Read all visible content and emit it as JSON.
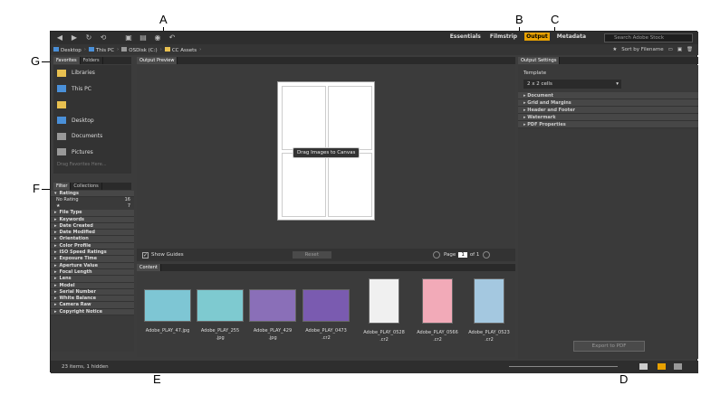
{
  "callouts": {
    "a": "A",
    "b": "B",
    "c": "C",
    "d": "D",
    "e": "E",
    "f": "F",
    "g": "G"
  },
  "toolbar": {
    "workspaces": [
      "Essentials",
      "Filmstrip",
      "Output",
      "Metadata"
    ],
    "active_workspace": "Output",
    "search_placeholder": "Search Adobe Stock"
  },
  "path": {
    "crumbs": [
      "Desktop",
      "This PC",
      "OSDisk (C:)",
      "CC Assets"
    ]
  },
  "pathbar_right": {
    "sort": "Sort by Filename"
  },
  "favorites": {
    "tabs": [
      "Favorites",
      "Folders"
    ],
    "items": [
      "Libraries",
      "This PC",
      " ",
      "Desktop",
      "Documents",
      "Pictures"
    ],
    "hint": "Drag Favorites Here..."
  },
  "filter": {
    "tabs": [
      "Filter",
      "Collections"
    ],
    "sections": [
      "Ratings",
      "File Type",
      "Keywords",
      "Date Created",
      "Date Modified",
      "Orientation",
      "Color Profile",
      "ISO Speed Ratings",
      "Exposure Time",
      "Aperture Value",
      "Focal Length",
      "Lens",
      "Model",
      "Serial Number",
      "White Balance",
      "Camera Raw",
      "Copyright Notice"
    ],
    "ratings": [
      {
        "label": "No Rating",
        "count": "16"
      },
      {
        "label": "★",
        "count": "7"
      }
    ]
  },
  "preview": {
    "tab": "Output Preview",
    "drag_tip": "Drag Images to Canvas",
    "show_guides": "Show Guides",
    "reset": "Reset",
    "page_label": "Page",
    "page_value": "1",
    "page_of": "of 1"
  },
  "content": {
    "tab": "Content",
    "thumbs": [
      "Adobe_PLAY_47.jpg",
      "Adobe_PLAY_255\n.jpg",
      "Adobe_PLAY_429\n.jpg",
      "Adobe_PLAY_0473\n.cr2",
      "Adobe_PLAY_0528\n.cr2",
      "Adobe_PLAY_0566\n.cr2",
      "Adobe_PLAY_0523\n.cr2"
    ],
    "thumb_colors": [
      "#7ec6d4",
      "#7ecad0",
      "#8a6fb8",
      "#7a5bb0",
      "#f0f0f0",
      "#f2aab8",
      "#a4c8e0"
    ]
  },
  "output_settings": {
    "tab": "Output Settings",
    "template_label": "Template",
    "template_value": "2 x 2 cells",
    "sections": [
      "Document",
      "Grid and Margins",
      "Header and Footer",
      "Watermark",
      "PDF Properties"
    ],
    "export": "Export to PDF"
  },
  "status": {
    "text": "23 items, 1 hidden"
  }
}
